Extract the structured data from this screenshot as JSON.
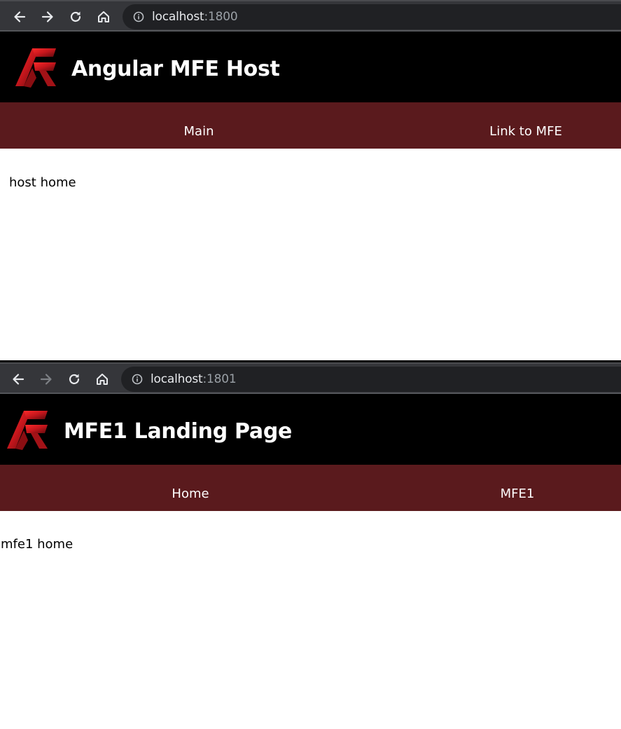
{
  "windows": [
    {
      "url": {
        "host": "localhost",
        "port": ":1800"
      },
      "app": {
        "title": "Angular MFE Host",
        "nav": [
          "Main",
          "Link to MFE"
        ],
        "content": "host home"
      }
    },
    {
      "url": {
        "host": "localhost",
        "port": ":1801"
      },
      "app": {
        "title": "MFE1 Landing Page",
        "nav": [
          "Home",
          "MFE1"
        ],
        "content": "mfe1 home"
      }
    }
  ],
  "icons": {
    "back": "arrow-left-icon",
    "forward": "arrow-right-icon",
    "reload": "reload-icon",
    "home": "home-icon",
    "info": "info-icon",
    "logo": "af-logo-icon"
  },
  "colors": {
    "browser_bar": "#35363a",
    "omnibox": "#202124",
    "header_bg": "#000000",
    "nav_bg": "#5a1a1d",
    "logo_red": "#c4161c"
  }
}
